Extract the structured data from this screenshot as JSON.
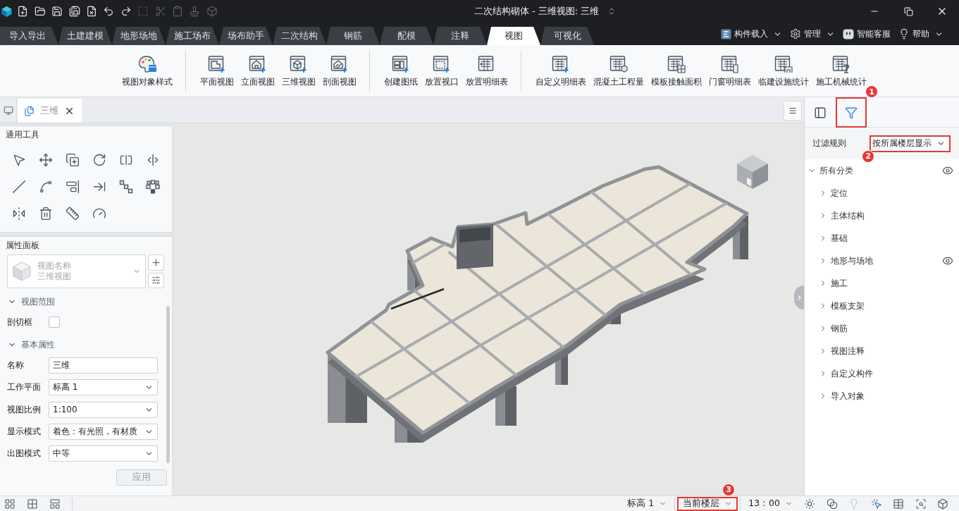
{
  "window": {
    "title": "二次结构砌体 - 三维视图: 三维"
  },
  "quick_toolbar": [
    {
      "disabled": false
    },
    {
      "disabled": false
    },
    {
      "disabled": false
    },
    {
      "disabled": false
    },
    {
      "disabled": false
    },
    {
      "disabled": false
    },
    {
      "disabled": false
    },
    {
      "disabled": true
    },
    {
      "disabled": true
    },
    {
      "disabled": true
    },
    {
      "disabled": true
    },
    {
      "disabled": true
    }
  ],
  "ribbon_tabs": [
    {
      "label": "导入导出",
      "selected": false
    },
    {
      "label": "土建建模",
      "selected": false
    },
    {
      "label": "地形场地",
      "selected": false
    },
    {
      "label": "施工场布",
      "selected": false
    },
    {
      "label": "场布助手",
      "selected": false
    },
    {
      "label": "二次结构",
      "selected": false
    },
    {
      "label": "钢筋",
      "selected": false
    },
    {
      "label": "配模",
      "selected": false
    },
    {
      "label": "注释",
      "selected": false
    },
    {
      "label": "视图",
      "selected": true
    },
    {
      "label": "可视化",
      "selected": false
    }
  ],
  "header_menus": [
    {
      "label": "构件载入",
      "dropdown": true
    },
    {
      "label": "管理",
      "dropdown": true
    },
    {
      "label": "智能客服",
      "dropdown": false
    },
    {
      "label": "帮助",
      "dropdown": true
    }
  ],
  "ribbon": {
    "groups": [
      {
        "buttons": [
          {
            "label": "视图对象样式"
          }
        ]
      },
      {
        "buttons": [
          {
            "label": "平面视图"
          },
          {
            "label": "立面视图"
          },
          {
            "label": "三维视图"
          },
          {
            "label": "剖面视图"
          }
        ]
      },
      {
        "buttons": [
          {
            "label": "创建图纸"
          },
          {
            "label": "放置视口"
          },
          {
            "label": "放置明细表"
          }
        ]
      },
      {
        "buttons": [
          {
            "label": "自定义明细表"
          },
          {
            "label": "混凝土工程量"
          },
          {
            "label": "模板接触面积"
          },
          {
            "label": "门窗明细表"
          },
          {
            "label": "临建设施统计"
          },
          {
            "label": "施工机械统计"
          }
        ]
      }
    ]
  },
  "document_tabs": [
    {
      "label": "三维",
      "selected": true
    }
  ],
  "tools_panel": {
    "title": "通用工具"
  },
  "properties_panel": {
    "title": "属性面板",
    "type_selector": {
      "name": "视图名称",
      "type": "三维视图"
    },
    "sections": [
      {
        "label": "视图范围",
        "expanded": true,
        "rows": [
          {
            "kind": "checkbox",
            "label": "剖切框",
            "checked": false
          }
        ]
      },
      {
        "label": "基本属性",
        "expanded": true,
        "rows": [
          {
            "kind": "text",
            "label": "名称",
            "value": "三维"
          },
          {
            "kind": "select",
            "label": "工作平面",
            "value": "标高 1"
          },
          {
            "kind": "select",
            "label": "视图比例",
            "value": "1:100"
          },
          {
            "kind": "select",
            "label": "显示模式",
            "value": "着色：有光照，有材质"
          },
          {
            "kind": "select",
            "label": "出图模式",
            "value": "中等"
          }
        ]
      }
    ],
    "apply_button": {
      "label": "应用",
      "disabled": true
    }
  },
  "filter_panel": {
    "tabs": [
      {
        "kind": "panel",
        "selected": false
      },
      {
        "kind": "filter",
        "selected": true,
        "callout": "1"
      }
    ],
    "filter_rule": {
      "label": "过滤规则",
      "value": "按所属楼层显示",
      "callout": "2"
    },
    "tree": [
      {
        "label": "所有分类",
        "expanded": true,
        "show_eye": true,
        "children": [
          {
            "label": "定位",
            "expanded": false,
            "show_eye": false
          },
          {
            "label": "主体结构",
            "expanded": false,
            "show_eye": false
          },
          {
            "label": "基础",
            "expanded": false,
            "show_eye": false
          },
          {
            "label": "地形与场地",
            "expanded": false,
            "show_eye": true
          },
          {
            "label": "施工",
            "expanded": false,
            "show_eye": false
          },
          {
            "label": "模板支架",
            "expanded": false,
            "show_eye": false
          },
          {
            "label": "钢筋",
            "expanded": false,
            "show_eye": false
          },
          {
            "label": "视图注释",
            "expanded": false,
            "show_eye": false
          },
          {
            "label": "自定义构件",
            "expanded": false,
            "show_eye": false
          },
          {
            "label": "导入对象",
            "expanded": false,
            "show_eye": false
          }
        ]
      }
    ]
  },
  "status_bar": {
    "selects": [
      {
        "value": "标高 1"
      },
      {
        "value": "当前楼层",
        "callout": "3"
      },
      {
        "value": "13：00"
      }
    ]
  }
}
